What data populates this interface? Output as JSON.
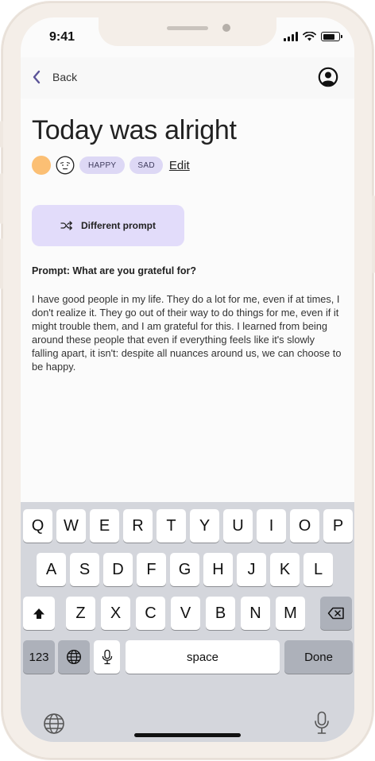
{
  "status_bar": {
    "time": "9:41",
    "icons": [
      "cellular-signal-icon",
      "wifi-icon",
      "battery-icon"
    ]
  },
  "nav": {
    "back_label": "Back",
    "back_icon": "chevron-left-icon",
    "profile_icon": "user-circle-icon"
  },
  "entry": {
    "title": "Today was alright",
    "mood_color": "#fbbf74",
    "mood_face_icon": "neutral-face-icon",
    "tags": [
      "HAPPY",
      "SAD"
    ],
    "edit_label": "Edit",
    "different_prompt_label": "Different prompt",
    "shuffle_icon": "shuffle-icon",
    "prompt": "Prompt: What are you grateful for?",
    "body": "I have good people in my life. They do a lot for me, even if at times, I don't realize it. They go out of their way to do things for me, even if it might trouble them, and I am grateful for this. I learned from being around these people that even if everything feels like it's slowly falling apart, it isn't: despite all nuances around us, we can choose to be happy."
  },
  "keyboard": {
    "row1": [
      "Q",
      "W",
      "E",
      "R",
      "T",
      "Y",
      "U",
      "I",
      "O",
      "P"
    ],
    "row2": [
      "A",
      "S",
      "D",
      "F",
      "G",
      "H",
      "J",
      "K",
      "L"
    ],
    "row3": [
      "Z",
      "X",
      "C",
      "V",
      "B",
      "N",
      "M"
    ],
    "shift_icon": "shift-icon",
    "delete_icon": "backspace-icon",
    "numbers_label": "123",
    "emoji_icon": "globe-icon",
    "mic_icon": "microphone-icon",
    "space_label": "space",
    "done_label": "Done",
    "bottom_globe_icon": "globe-icon",
    "bottom_mic_icon": "microphone-icon"
  },
  "colors": {
    "accent": "#e2dcfa",
    "tag_bg": "#ddd8f5",
    "back_chevron": "#5b5498",
    "keyboard_bg": "#d4d6dc"
  }
}
